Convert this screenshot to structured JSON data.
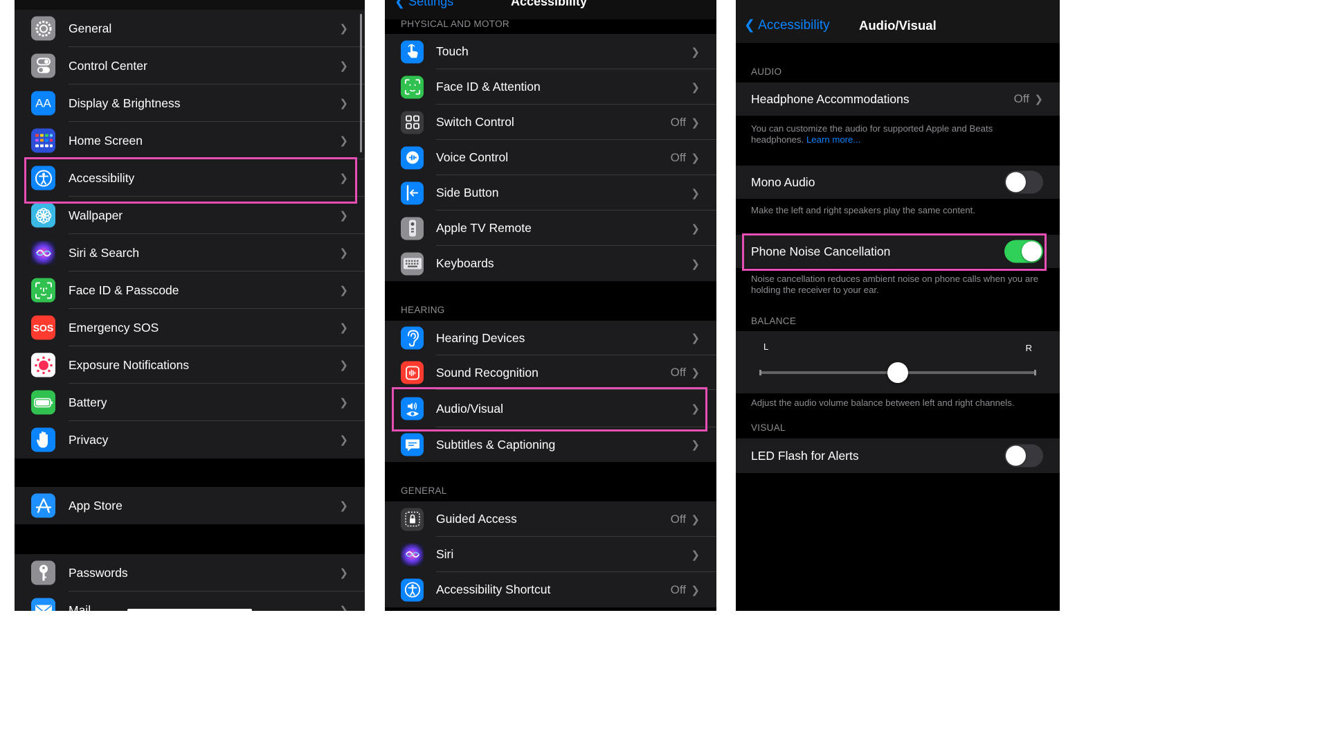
{
  "settings_panel": {
    "groups": [
      {
        "items": [
          {
            "label": "General"
          },
          {
            "label": "Control Center"
          },
          {
            "label": "Display & Brightness",
            "icon_text": "AA"
          },
          {
            "label": "Home Screen"
          },
          {
            "label": "Accessibility"
          },
          {
            "label": "Wallpaper"
          },
          {
            "label": "Siri & Search"
          },
          {
            "label": "Face ID & Passcode"
          },
          {
            "label": "Emergency SOS",
            "icon_text": "SOS"
          },
          {
            "label": "Exposure Notifications"
          },
          {
            "label": "Battery"
          },
          {
            "label": "Privacy"
          }
        ]
      },
      {
        "items": [
          {
            "label": "App Store"
          }
        ]
      },
      {
        "items": [
          {
            "label": "Passwords"
          },
          {
            "label": "Mail"
          }
        ]
      }
    ]
  },
  "accessibility_panel": {
    "nav": {
      "back_label": "Settings",
      "title": "Accessibility"
    },
    "sections": [
      {
        "header": "PHYSICAL AND MOTOR",
        "items": [
          {
            "label": "Touch",
            "value": ""
          },
          {
            "label": "Face ID & Attention",
            "value": ""
          },
          {
            "label": "Switch Control",
            "value": "Off"
          },
          {
            "label": "Voice Control",
            "value": "Off"
          },
          {
            "label": "Side Button",
            "value": ""
          },
          {
            "label": "Apple TV Remote",
            "value": ""
          },
          {
            "label": "Keyboards",
            "value": ""
          }
        ]
      },
      {
        "header": "HEARING",
        "items": [
          {
            "label": "Hearing Devices",
            "value": ""
          },
          {
            "label": "Sound Recognition",
            "value": "Off"
          },
          {
            "label": "Audio/Visual",
            "value": ""
          },
          {
            "label": "Subtitles & Captioning",
            "value": ""
          }
        ]
      },
      {
        "header": "GENERAL",
        "items": [
          {
            "label": "Guided Access",
            "value": "Off"
          },
          {
            "label": "Siri",
            "value": ""
          },
          {
            "label": "Accessibility Shortcut",
            "value": "Off"
          }
        ]
      }
    ]
  },
  "audio_visual_panel": {
    "nav": {
      "back_label": "Accessibility",
      "title": "Audio/Visual"
    },
    "audio_header": "AUDIO",
    "headphone": {
      "label": "Headphone Accommodations",
      "value": "Off"
    },
    "headphone_footer": "You can customize the audio for supported Apple and Beats headphones.",
    "headphone_link": "Learn more...",
    "mono": {
      "label": "Mono Audio",
      "on": false
    },
    "mono_footer": "Make the left and right speakers play the same content.",
    "noise": {
      "label": "Phone Noise Cancellation",
      "on": true
    },
    "noise_footer": "Noise cancellation reduces ambient noise on phone calls when you are holding the receiver to your ear.",
    "balance_header": "BALANCE",
    "balance": {
      "left_label": "L",
      "right_label": "R",
      "value": 0.5
    },
    "balance_footer": "Adjust the audio volume balance between left and right channels.",
    "visual_header": "VISUAL",
    "led": {
      "label": "LED Flash for Alerts",
      "on": false
    }
  },
  "colors": {
    "highlight": "#e84fb4",
    "accent": "#0a84ff",
    "toggle_on": "#30d158"
  }
}
